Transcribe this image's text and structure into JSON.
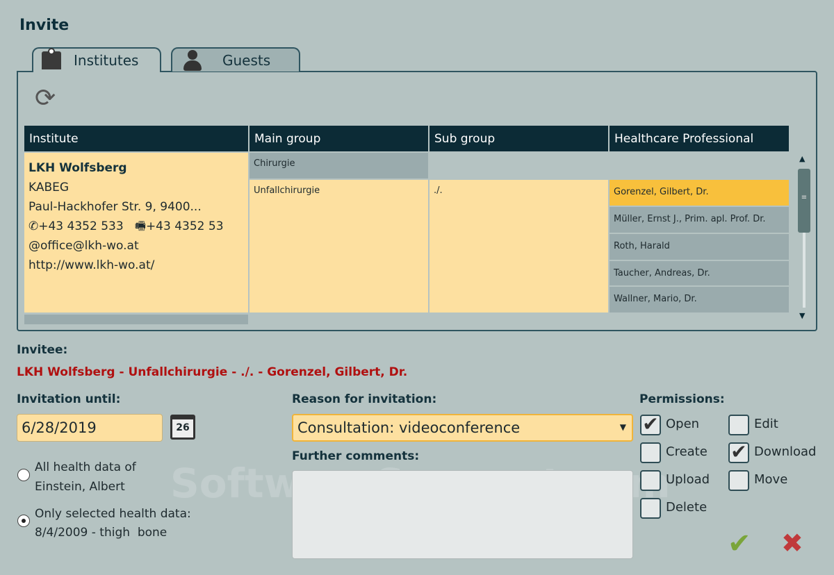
{
  "dialog": {
    "title": "Invite",
    "watermark": "SoftwareSuggest.com"
  },
  "tabs": [
    {
      "label": "Institutes",
      "icon": "hospital-icon"
    },
    {
      "label": "Guests",
      "icon": "person-icon"
    }
  ],
  "table": {
    "headers": [
      "Institute",
      "Main group",
      "Sub group",
      "Healthcare Professional"
    ],
    "institute": {
      "name": "LKH Wolfsberg",
      "org": "KABEG",
      "address": "Paul-Hackhofer Str. 9, 9400...",
      "phone": "+43 4352 533",
      "fax": "+43 4352 53",
      "email": "office@lkh-wo.at",
      "web": "http://www.lkh-wo.at/"
    },
    "main_groups": [
      "Chirurgie",
      "Unfallchirurgie"
    ],
    "sub_group": "./.",
    "professionals": [
      "Gorenzel, Gilbert, Dr.",
      "Müller, Ernst J., Prim. apl. Prof. Dr.",
      "Roth, Harald",
      "Taucher, Andreas, Dr.",
      "Wallner, Mario, Dr."
    ],
    "selected_professional": 0
  },
  "invitee": {
    "label": "Invitee:",
    "value": "LKH Wolfsberg - Unfallchirurgie - ./. - Gorenzel, Gilbert, Dr."
  },
  "until": {
    "label": "Invitation until:",
    "date": "6/28/2019",
    "calendar_day": "26"
  },
  "scope": {
    "options": [
      "All health data of Einstein, Albert",
      "Only selected health data: 8/4/2009 - thigh  bone"
    ],
    "opt1_l1": "All health data of",
    "opt1_l2": "Einstein, Albert",
    "opt2_l1": "Only selected health data:",
    "opt2_l2": "8/4/2009 - thigh  bone",
    "selected": 1
  },
  "reason": {
    "label": "Reason for invitation:",
    "value": "Consultation: videoconference"
  },
  "comments": {
    "label": "Further comments:",
    "value": ""
  },
  "permissions": {
    "label": "Permissions:",
    "items": [
      {
        "label": "Open",
        "checked": true
      },
      {
        "label": "Edit",
        "checked": false
      },
      {
        "label": "Create",
        "checked": false
      },
      {
        "label": "Download",
        "checked": true
      },
      {
        "label": "Upload",
        "checked": false
      },
      {
        "label": "Move",
        "checked": false
      },
      {
        "label": "Delete",
        "checked": false
      }
    ]
  },
  "colors": {
    "header": "#0c2b36",
    "selected": "#f8c03c",
    "cell": "#fde0a0",
    "invitee": "#b01010"
  }
}
